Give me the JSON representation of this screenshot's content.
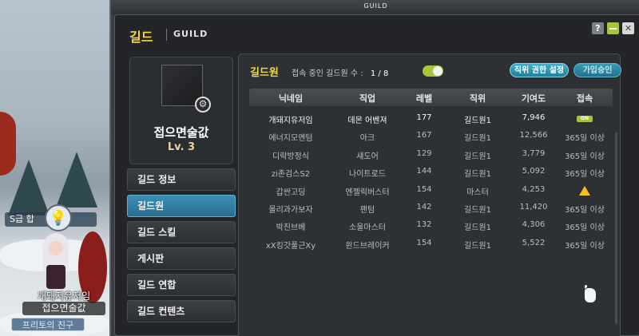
{
  "window": {
    "title": "GUILD",
    "header_kr": "길드",
    "header_en": "GUILD",
    "help_label": "?",
    "gear_label": "⚙"
  },
  "guild": {
    "name": "접으면술값",
    "level": "Lv. 3"
  },
  "menu": [
    {
      "label": "길드 정보",
      "active": false
    },
    {
      "label": "길드원",
      "active": true
    },
    {
      "label": "길드 스킬",
      "active": false
    },
    {
      "label": "게시판",
      "active": false
    },
    {
      "label": "길드 연합",
      "active": false
    },
    {
      "label": "길드 컨텐츠",
      "active": false
    }
  ],
  "members_panel": {
    "title": "길드원",
    "online_label": "접속 중인 길드원 수 :",
    "online_count": "1 / 8",
    "rank_settings_button": "직위 권한 설정",
    "join_approval_button": "가입승인",
    "columns": [
      "닉네임",
      "직업",
      "레벨",
      "직위",
      "기여도",
      "접속"
    ],
    "rows": [
      {
        "nick": "개돼지유저임",
        "job": "데몬 어벤져",
        "level": "177",
        "rank": "길드원1",
        "contribution": "7,946",
        "status": "ON",
        "status_type": "online"
      },
      {
        "nick": "에너지모멘텀",
        "job": "아크",
        "level": "167",
        "rank": "길드원1",
        "contribution": "12,566",
        "status": "365일 이상",
        "status_type": "text"
      },
      {
        "nick": "디락방정식",
        "job": "섀도어",
        "level": "129",
        "rank": "길드원1",
        "contribution": "3,779",
        "status": "365일 이상",
        "status_type": "text"
      },
      {
        "nick": "zi존검스S2",
        "job": "나이트로드",
        "level": "144",
        "rank": "길드원1",
        "contribution": "5,092",
        "status": "365일 이상",
        "status_type": "text"
      },
      {
        "nick": "갑싼고딩",
        "job": "엔젤릭버스터",
        "level": "154",
        "rank": "마스터",
        "contribution": "4,253",
        "status": "",
        "status_type": "warning"
      },
      {
        "nick": "몰리과가보자",
        "job": "팬텀",
        "level": "142",
        "rank": "길드원1",
        "contribution": "11,420",
        "status": "365일 이상",
        "status_type": "text"
      },
      {
        "nick": "박친브베",
        "job": "소울마스터",
        "level": "132",
        "rank": "길드원1",
        "contribution": "4,306",
        "status": "365일 이상",
        "status_type": "text"
      },
      {
        "nick": "xX킹갓풀근Xy",
        "job": "윈드브레이커",
        "level": "154",
        "rank": "길드원1",
        "contribution": "5,522",
        "status": "365일 이상",
        "status_type": "text"
      }
    ]
  },
  "character": {
    "tag": "S급 합",
    "name": "개돼지유저임",
    "guild": "접으면술값",
    "badge": "프리토의 친구"
  },
  "colors": {
    "accent_yellow": "#f4d942",
    "menu_active": "#3a8fb3",
    "toggle_green": "#a8c33c"
  }
}
